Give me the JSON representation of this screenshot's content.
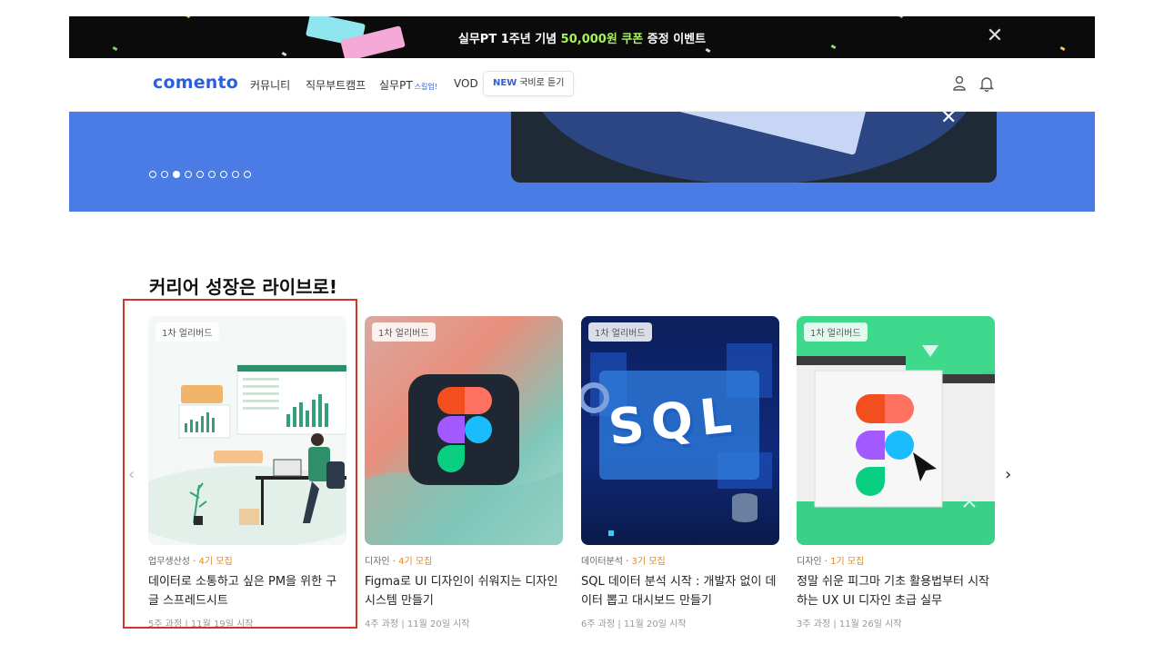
{
  "promo": {
    "text_before": "실무PT 1주년 기념 ",
    "text_highlight": "50,000원 쿠폰",
    "text_after": " 증정 이벤트",
    "close_icon": "close-icon",
    "highlight_color": "#a6f35b"
  },
  "nav": {
    "logo": "comento",
    "items": [
      {
        "label": "커뮤니티"
      },
      {
        "label": "직무부트캠프"
      },
      {
        "label": "실무PT",
        "tag": "스킬업!"
      },
      {
        "label": "VOD"
      }
    ],
    "new_badge": "NEW",
    "new_label": "국비로 듣기",
    "user_icon": "user-icon",
    "bell_icon": "bell-icon"
  },
  "hero": {
    "slide_count": 9,
    "active_index": 2,
    "close_icon": "close-icon"
  },
  "section": {
    "title": "커리어 성장은 라이브로!",
    "prev_icon": "chevron-left-icon",
    "next_icon": "chevron-right-icon"
  },
  "cards": [
    {
      "badge": "1차 얼리버드",
      "category": "업무생산성",
      "recruit": "4기 모집",
      "title": "데이터로 소통하고 싶은 PM을 위한 구글 스프레드시트",
      "duration": "5주 과정",
      "start": "11월 19일 시작",
      "image": "spreadsheet-illustration"
    },
    {
      "badge": "1차 얼리버드",
      "category": "디자인",
      "recruit": "4기 모집",
      "title": "Figma로 UI 디자인이 쉬워지는 디자인시스템 만들기",
      "duration": "4주 과정",
      "start": "11월 20일 시작",
      "image": "figma-logo-illustration"
    },
    {
      "badge": "1차 얼리버드",
      "category": "데이터분석",
      "recruit": "3기 모집",
      "title": "SQL 데이터 분석 시작 : 개발자 없이 데이터 뽑고 대시보드 만들기",
      "duration": "6주 과정",
      "start": "11월 20일 시작",
      "image": "sql-illustration",
      "image_text": "SQL"
    },
    {
      "badge": "1차 얼리버드",
      "category": "디자인",
      "recruit": "1기 모집",
      "title": "정말 쉬운 피그마 기초 활용법부터 시작하는 UX UI 디자인 초급 실무",
      "duration": "3주 과정",
      "start": "11월 26일 시작",
      "image": "figma-browser-illustration"
    }
  ]
}
